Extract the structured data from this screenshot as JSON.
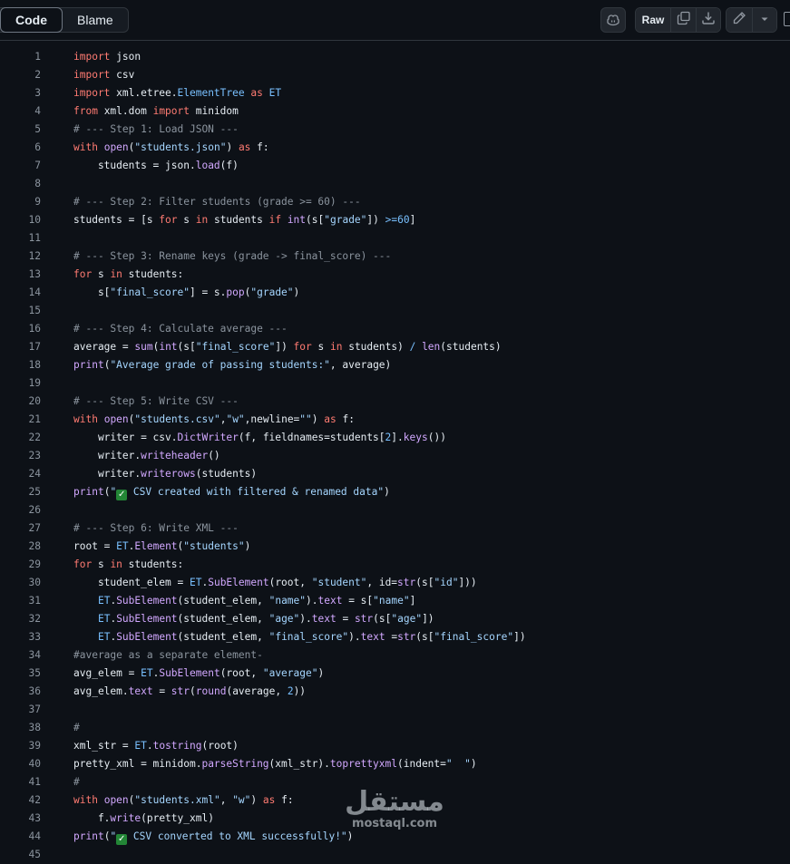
{
  "toolbar": {
    "tab_code": "Code",
    "tab_blame": "Blame",
    "raw_label": "Raw"
  },
  "icons": {
    "copilot": "copilot-icon",
    "copy": "copy-icon",
    "download": "download-icon",
    "edit": "pencil-icon",
    "caret": "triangle-down-icon",
    "symbols": "sidebar-panel-icon"
  },
  "colors": {
    "background": "#0d1117",
    "keyword": "#ff7b72",
    "function": "#d2a8ff",
    "string": "#a5d6ff",
    "comment": "#8b949e",
    "constant": "#79c0ff",
    "checkmark": "#238636"
  },
  "code": {
    "line_numbers": [
      "1",
      "2",
      "3",
      "4",
      "5",
      "6",
      "7",
      "8",
      "9",
      "10",
      "11",
      "12",
      "13",
      "14",
      "15",
      "16",
      "17",
      "18",
      "19",
      "20",
      "21",
      "22",
      "23",
      "24",
      "25",
      "26",
      "27",
      "28",
      "29",
      "30",
      "31",
      "32",
      "33",
      "34",
      "35",
      "36",
      "37",
      "38",
      "39",
      "40",
      "41",
      "42",
      "43",
      "44",
      "45"
    ],
    "lines": [
      "import json",
      "import csv",
      "import xml.etree.ElementTree as ET",
      "from xml.dom import minidom",
      "# --- Step 1: Load JSON ---",
      "with open(\"students.json\") as f:",
      "    students = json.load(f)",
      "",
      "# --- Step 2: Filter students (grade >= 60) ---",
      "students = [s for s in students if int(s[\"grade\"]) >=60]",
      "",
      "# --- Step 3: Rename keys (grade -> final_score) ---",
      "for s in students:",
      "    s[\"final_score\"] = s.pop(\"grade\")",
      "",
      "# --- Step 4: Calculate average ---",
      "average = sum(int(s[\"final_score\"]) for s in students) / len(students)",
      "print(\"Average grade of passing students:\", average)",
      "",
      "# --- Step 5: Write CSV ---",
      "with open(\"students.csv\",\"w\",newline=\"\") as f:",
      "    writer = csv.DictWriter(f, fieldnames=students[2].keys())",
      "    writer.writeheader()",
      "    writer.writerows(students)",
      "print(\"✅ CSV created with filtered & renamed data\")",
      "",
      "# --- Step 6: Write XML ---",
      "root = ET.Element(\"students\")",
      "for s in students:",
      "    student_elem = ET.SubElement(root, \"student\", id=str(s[\"id\"]))",
      "    ET.SubElement(student_elem, \"name\").text = s[\"name\"]",
      "    ET.SubElement(student_elem, \"age\").text = str(s[\"age\"])",
      "    ET.SubElement(student_elem, \"final_score\").text =str(s[\"final_score\"])",
      "#average as a separate element-",
      "avg_elem = ET.SubElement(root, \"average\")",
      "avg_elem.text = str(round(average, 2))",
      "",
      "#",
      "xml_str = ET.tostring(root)",
      "pretty_xml = minidom.parseString(xml_str).toprettyxml(indent=\"  \")",
      "#",
      "with open(\"students.xml\", \"w\") as f:",
      "    f.write(pretty_xml)",
      "print(\"✅ CSV converted to XML successfully!\")",
      ""
    ]
  },
  "watermark": {
    "arabic": "مستقل",
    "latin": "mostaql.com"
  }
}
